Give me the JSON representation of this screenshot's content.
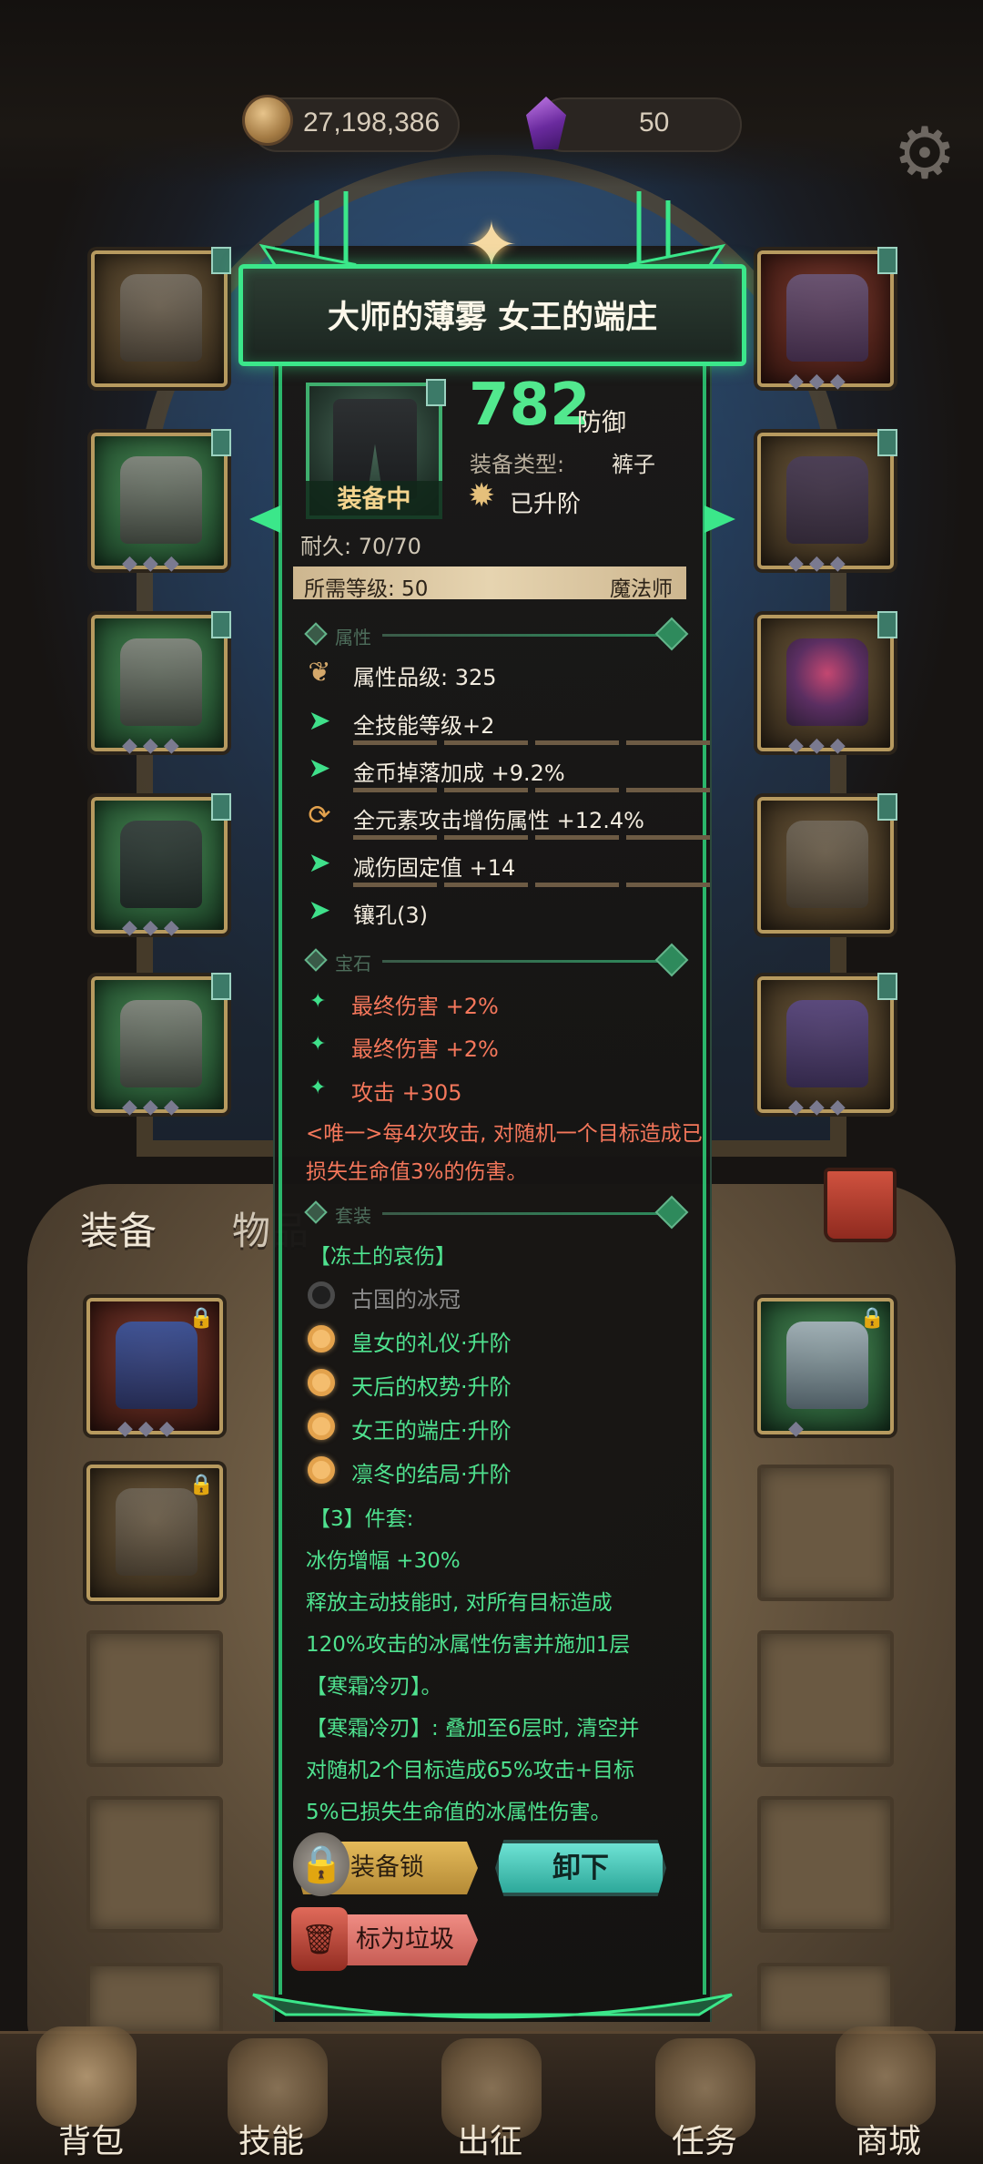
{
  "currency": {
    "gold": "27,198,386",
    "gems": "50"
  },
  "icons": {
    "settings": "gear-icon",
    "gold": "coin-icon",
    "gem": "crystal-icon"
  },
  "colors": {
    "accent_green": "#3be78a",
    "gem_red": "#f5775b",
    "set_orange": "#f4bd6e",
    "panel_dark": "#1a1816"
  },
  "item": {
    "name": "大师的薄雾 女王的端庄",
    "defense_value": "782",
    "defense_label": "防御",
    "type_label": "装备类型:",
    "type_value": "裤子",
    "equipped_label": "装备中",
    "upgraded_label": "已升阶",
    "durability": "耐久: 70/70",
    "required_level": "所需等级: 50",
    "class": "魔法师"
  },
  "attributes": {
    "header": "属性",
    "quality": "属性品级: 325",
    "lines": [
      {
        "icon": "arrow-icon",
        "text": "全技能等级+2"
      },
      {
        "icon": "arrow-icon",
        "text": "金币掉落加成 +9.2%"
      },
      {
        "icon": "refresh-icon",
        "text": "全元素攻击增伤属性 +12.4%"
      },
      {
        "icon": "arrow-icon",
        "text": "减伤固定值 +14"
      },
      {
        "icon": "arrow-icon",
        "text": "镶孔(3)"
      }
    ]
  },
  "gems": {
    "header": "宝石",
    "lines": [
      "最终伤害 +2%",
      "最终伤害 +2%",
      "攻击 +305"
    ],
    "unique": "<唯一>每4次攻击, 对随机一个目标造成已损失生命值3%的伤害。"
  },
  "set": {
    "header": "套装",
    "name": "【冻土的哀伤】",
    "pieces": [
      {
        "text": "古国的冰冠",
        "active": false
      },
      {
        "text": "皇女的礼仪·升阶",
        "active": true
      },
      {
        "text": "天后的权势·升阶",
        "active": true
      },
      {
        "text": "女王的端庄·升阶",
        "active": true
      },
      {
        "text": "凛冬的结局·升阶",
        "active": true
      }
    ],
    "bonus_title": "【3】件套:",
    "bonus_lines": [
      "冰伤增幅 +30%",
      "释放主动技能时, 对所有目标造成",
      "120%攻击的冰属性伤害并施加1层",
      "【寒霜冷刃】。",
      "【寒霜冷刃】: 叠加至6层时, 清空并",
      "对随机2个目标造成65%攻击+目标",
      "5%已损失生命值的冰属性伤害。"
    ]
  },
  "buttons": {
    "lock": "装备锁",
    "unequip": "卸下",
    "mark_trash": "标为垃圾"
  },
  "sack_tabs": {
    "equipment": "装备",
    "items": "物品"
  },
  "nav": [
    "背包",
    "技能",
    "出征",
    "任务",
    "商城"
  ]
}
